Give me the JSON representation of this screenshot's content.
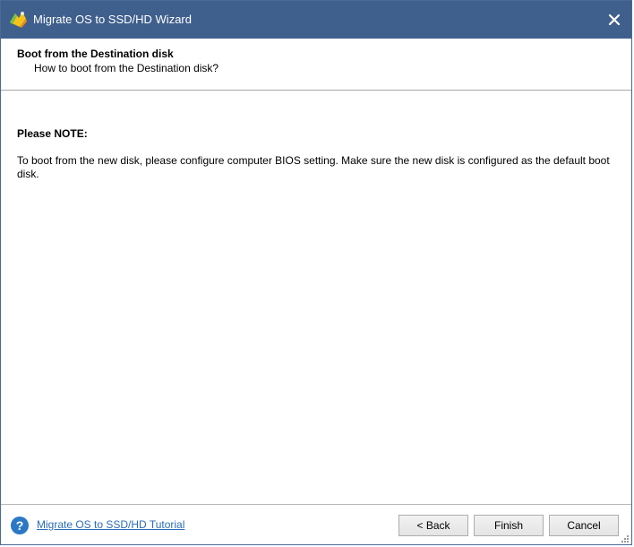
{
  "window": {
    "title": "Migrate OS to SSD/HD Wizard",
    "title_bar_color": "#3f5f8d"
  },
  "header": {
    "title": "Boot from the Destination disk",
    "subtitle": "How to boot from the Destination disk?"
  },
  "content": {
    "note_heading": "Please NOTE:",
    "note_body": "To boot from the new disk, please configure computer BIOS setting. Make sure the new disk is configured as the default boot disk."
  },
  "footer": {
    "help_icon": "question-icon",
    "tutorial_link": "Migrate OS to SSD/HD Tutorial",
    "link_color": "#2b6cb8",
    "buttons": {
      "back": "< Back",
      "finish": "Finish",
      "cancel": "Cancel"
    }
  }
}
